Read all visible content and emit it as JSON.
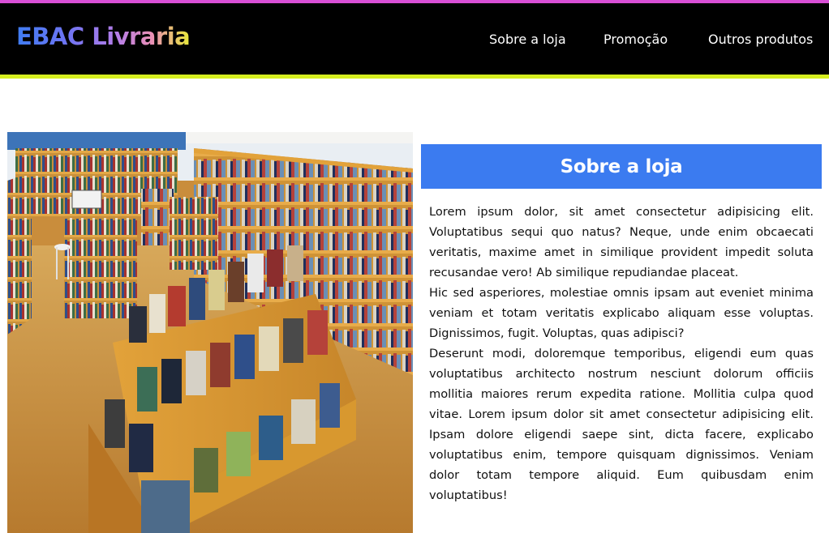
{
  "header": {
    "logo_text": "EBAC Livraria",
    "nav": [
      {
        "label": "Sobre a loja"
      },
      {
        "label": "Promoção"
      },
      {
        "label": "Outros produtos"
      }
    ]
  },
  "colors": {
    "top_stripe": "#d84fd6",
    "navbar_bg": "#000000",
    "bottom_stripe": "#d6ef1f",
    "section_title_bg": "#3b7bf0"
  },
  "main": {
    "image_icon": "bookstore-photo",
    "section_title": "Sobre a loja",
    "paragraphs": [
      "Lorem ipsum dolor, sit amet consectetur adipisicing elit. Voluptatibus sequi quo natus? Neque, unde enim obcaecati veritatis, maxime amet in similique provident impedit soluta recusandae vero! Ab similique repudiandae placeat.",
      "Hic sed asperiores, molestiae omnis ipsam aut eveniet minima veniam et totam veritatis explicabo aliquam esse voluptas. Dignissimos, fugit. Voluptas, quas adipisci?",
      "Deserunt modi, doloremque temporibus, eligendi eum quas voluptatibus architecto nostrum nesciunt dolorum officiis mollitia maiores rerum expedita ratione. Mollitia culpa quod vitae. Lorem ipsum dolor sit amet consectetur adipisicing elit. Ipsam dolore eligendi saepe sint, dicta facere, explicabo voluptatibus enim, tempore quisquam dignissimos. Veniam dolor totam tempore aliquid. Eum quibusdam enim voluptatibus!"
    ]
  }
}
